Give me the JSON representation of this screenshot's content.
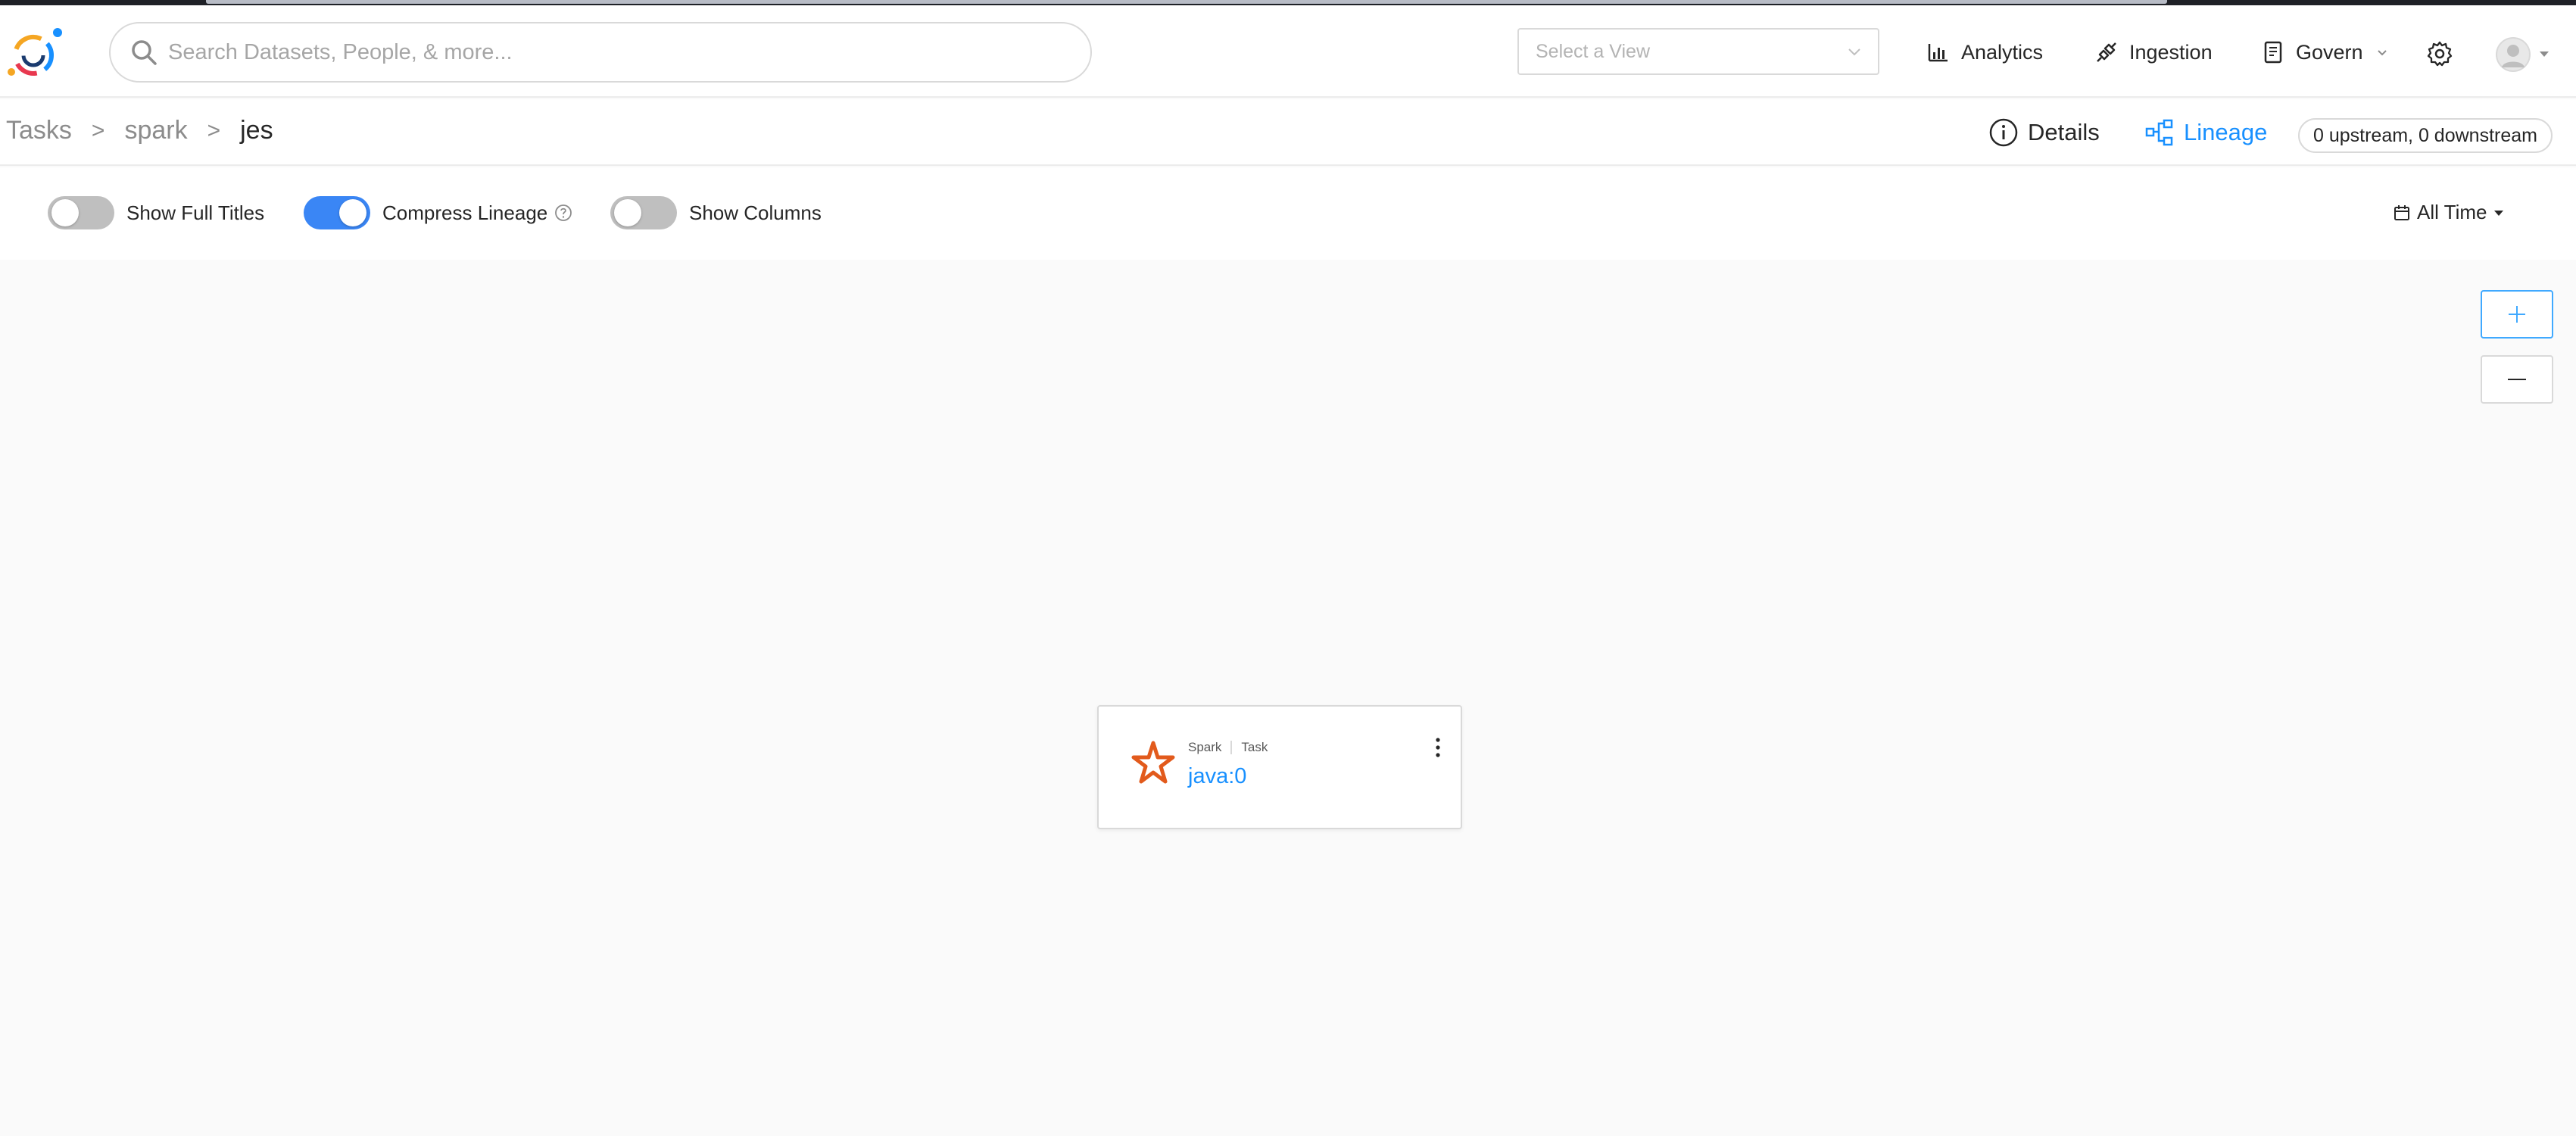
{
  "header": {
    "search_placeholder": "Search Datasets, People, & more...",
    "view_select_placeholder": "Select a View",
    "nav": {
      "analytics": "Analytics",
      "ingestion": "Ingestion",
      "govern": "Govern"
    },
    "icons": [
      "logo-icon",
      "search-icon",
      "chevron-down-icon",
      "bar-chart-icon",
      "plug-icon",
      "book-icon",
      "gear-icon",
      "avatar-icon"
    ]
  },
  "breadcrumb": {
    "items": [
      "Tasks",
      "spark",
      "jes"
    ],
    "separator": ">"
  },
  "tabs": {
    "details": "Details",
    "lineage": "Lineage",
    "counts": "0 upstream, 0 downstream"
  },
  "controls": {
    "show_full_titles": {
      "label": "Show Full Titles",
      "on": false
    },
    "compress_lineage": {
      "label": "Compress Lineage",
      "on": true
    },
    "show_columns": {
      "label": "Show Columns",
      "on": false
    },
    "time_filter": "All Time"
  },
  "node": {
    "platform": "Spark",
    "entity_type": "Task",
    "name": "java:0"
  },
  "colors": {
    "accent": "#1890ff",
    "toggle_on": "#3a86f5",
    "toggle_off": "#bfbfbf",
    "spark_orange": "#e25a1c"
  }
}
